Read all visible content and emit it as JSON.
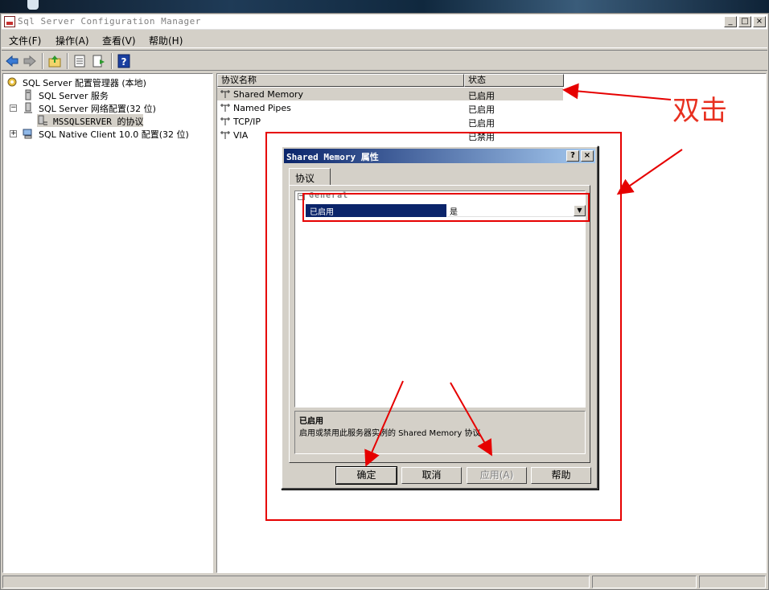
{
  "window": {
    "title": "Sql Server Configuration Manager",
    "minimize": "_",
    "maximize": "□",
    "close": "×"
  },
  "menu": [
    "文件(F)",
    "操作(A)",
    "查看(V)",
    "帮助(H)"
  ],
  "tree": {
    "root": "SQL Server 配置管理器 (本地)",
    "services": "SQL Server 服务",
    "network": "SQL Server 网络配置(32 位)",
    "protocols": "MSSQLSERVER 的协议",
    "client": "SQL Native Client 10.0 配置(32 位)",
    "expand_plus": "+",
    "expand_minus": "−"
  },
  "list": {
    "columns": [
      "协议名称",
      "状态"
    ],
    "rows": [
      {
        "name": "Shared Memory",
        "state": "已启用"
      },
      {
        "name": "Named Pipes",
        "state": "已启用"
      },
      {
        "name": "TCP/IP",
        "state": "已启用"
      },
      {
        "name": "VIA",
        "state": "已禁用"
      }
    ]
  },
  "dialog": {
    "title": "Shared Memory 属性",
    "help_btn": "?",
    "close_btn": "×",
    "tab": "协议",
    "group": "General",
    "group_toggle": "−",
    "property_key": "已启用",
    "property_value": "是",
    "dropdown_arrow": "▼",
    "help_title": "已启用",
    "help_text": "启用或禁用此服务器实例的 Shared Memory 协议",
    "buttons": {
      "ok": "确定",
      "cancel": "取消",
      "apply": "应用(A)",
      "help": "帮助"
    }
  },
  "annotation": {
    "label": "双击",
    "color": "#e60000"
  }
}
